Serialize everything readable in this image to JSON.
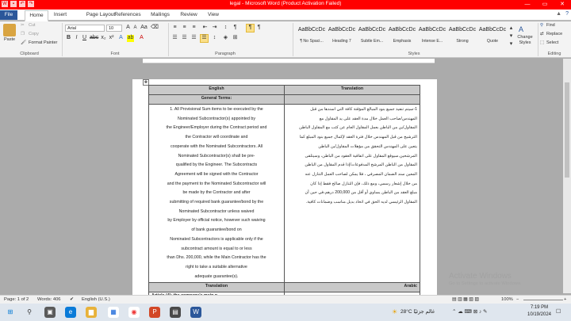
{
  "window": {
    "title": "legal - Microsoft Word (Product Activation Failed)"
  },
  "tabs": [
    "File",
    "Home",
    "Insert",
    "Page Layout",
    "References",
    "Mailings",
    "Review",
    "View"
  ],
  "clipboard": {
    "paste": "Paste",
    "cut": "Cut",
    "copy": "Copy",
    "format_painter": "Format Painter",
    "label": "Clipboard"
  },
  "font": {
    "name": "Arial",
    "size": "10",
    "label": "Font"
  },
  "paragraph": {
    "label": "Paragraph"
  },
  "styles": {
    "label": "Styles",
    "items": [
      {
        "sample": "AaBbCcDc",
        "name": "¶ No Spaci..."
      },
      {
        "sample": "AaBbCcDc",
        "name": "Heading 7"
      },
      {
        "sample": "AaBbCcDc",
        "name": "Subtle Em..."
      },
      {
        "sample": "AaBbCcDc",
        "name": "Emphasis"
      },
      {
        "sample": "AaBbCcDc",
        "name": "Intense E..."
      },
      {
        "sample": "AaBbCcDc",
        "name": "Strong"
      },
      {
        "sample": "AaBbCcDc",
        "name": "Quote"
      }
    ],
    "change": "Change Styles"
  },
  "editing": {
    "find": "Find",
    "replace": "Replace",
    "select": "Select",
    "label": "Editing"
  },
  "table": {
    "header": [
      "English",
      "Translation"
    ],
    "section": "General Terms:",
    "english_lines": [
      "1. All Provisional Sum items to be executed by the",
      "Nominated Subcontractor(s) appointed by",
      "the Engineer/Employer during the Contract period and",
      "the Contractor will coordinate and",
      "cooperate with the Nominated Subcontractors. All",
      "Nominated Subcontractor(s) shall be pre-",
      "qualified by the Engineer. The Subcontracts",
      "Agreement will be signed with the Contractor",
      "and the payment to the Nominated Subcontractor will",
      "be made by the Contractor and after",
      "submitting of required bank guarantee/bond by the",
      "Nominated Subcontractor unless waived",
      "by Employer by official notice, however such waiving",
      "of bank guarantee/bond on",
      "Nominated Subcontractors is applicable only if the",
      "subcontract amount is equal to or less",
      "than Dhs. 200,000, while the Main Contractor has the",
      "right to take a suitable alternative",
      "adequate guarantee(s)."
    ],
    "arabic_lines": [
      "1-سيتم تنفيذ جميع بنود المبالغ المؤقتة كافة التي اسندها من قبل",
      "المهندس/صاحب العمل خلال مدة العقد على يد المقاول مع",
      "المقاول/ين من الباطن بعمل المقاول العام عن كثب مع المقاول الباطن",
      "الترشيح من قبل المهندس خلال فترة العقد لإكمال جميع بنود المبلغ كما",
      "يتعين على المهندس التحقق من مؤهلات المقاول/ين الباطن",
      "المرشحين.سيوقع المقاول على اتفاقية العقود من الباطن، وسيتلقى",
      "المقاول من الباطن المرشح المدفوعات/إذا قدم المقاول من الباطن",
      "المعين سند الضمان المصرفي ، فلا يمكن لصاحب العمل التنازل عنه",
      "من خلال إشعار رسمي، ومع ذلك، فإن التنازل صالح فقط إذا كان",
      "مبلغ العقد من الباطن يساوي أو أقل من 200,000 درهم،في حين أن",
      "المقاول الرئيسي لديه الحق في اتخاذ بديل مناسب وضمانات كافية."
    ],
    "footer_header": [
      "Translation",
      "Arabic"
    ],
    "next_row": "Article (4): the company's main p..."
  },
  "status": {
    "page": "Page: 1 of 2",
    "words": "Words: 406",
    "language": "English (U.S.)",
    "zoom": "100%"
  },
  "watermark": {
    "line1": "Activate Windows",
    "line2": "Go to Settings to activate Windows."
  },
  "taskbar": {
    "weather": "28°C غالم جزئيًا",
    "time": "7:19 PM",
    "date": "10/19/2024"
  }
}
